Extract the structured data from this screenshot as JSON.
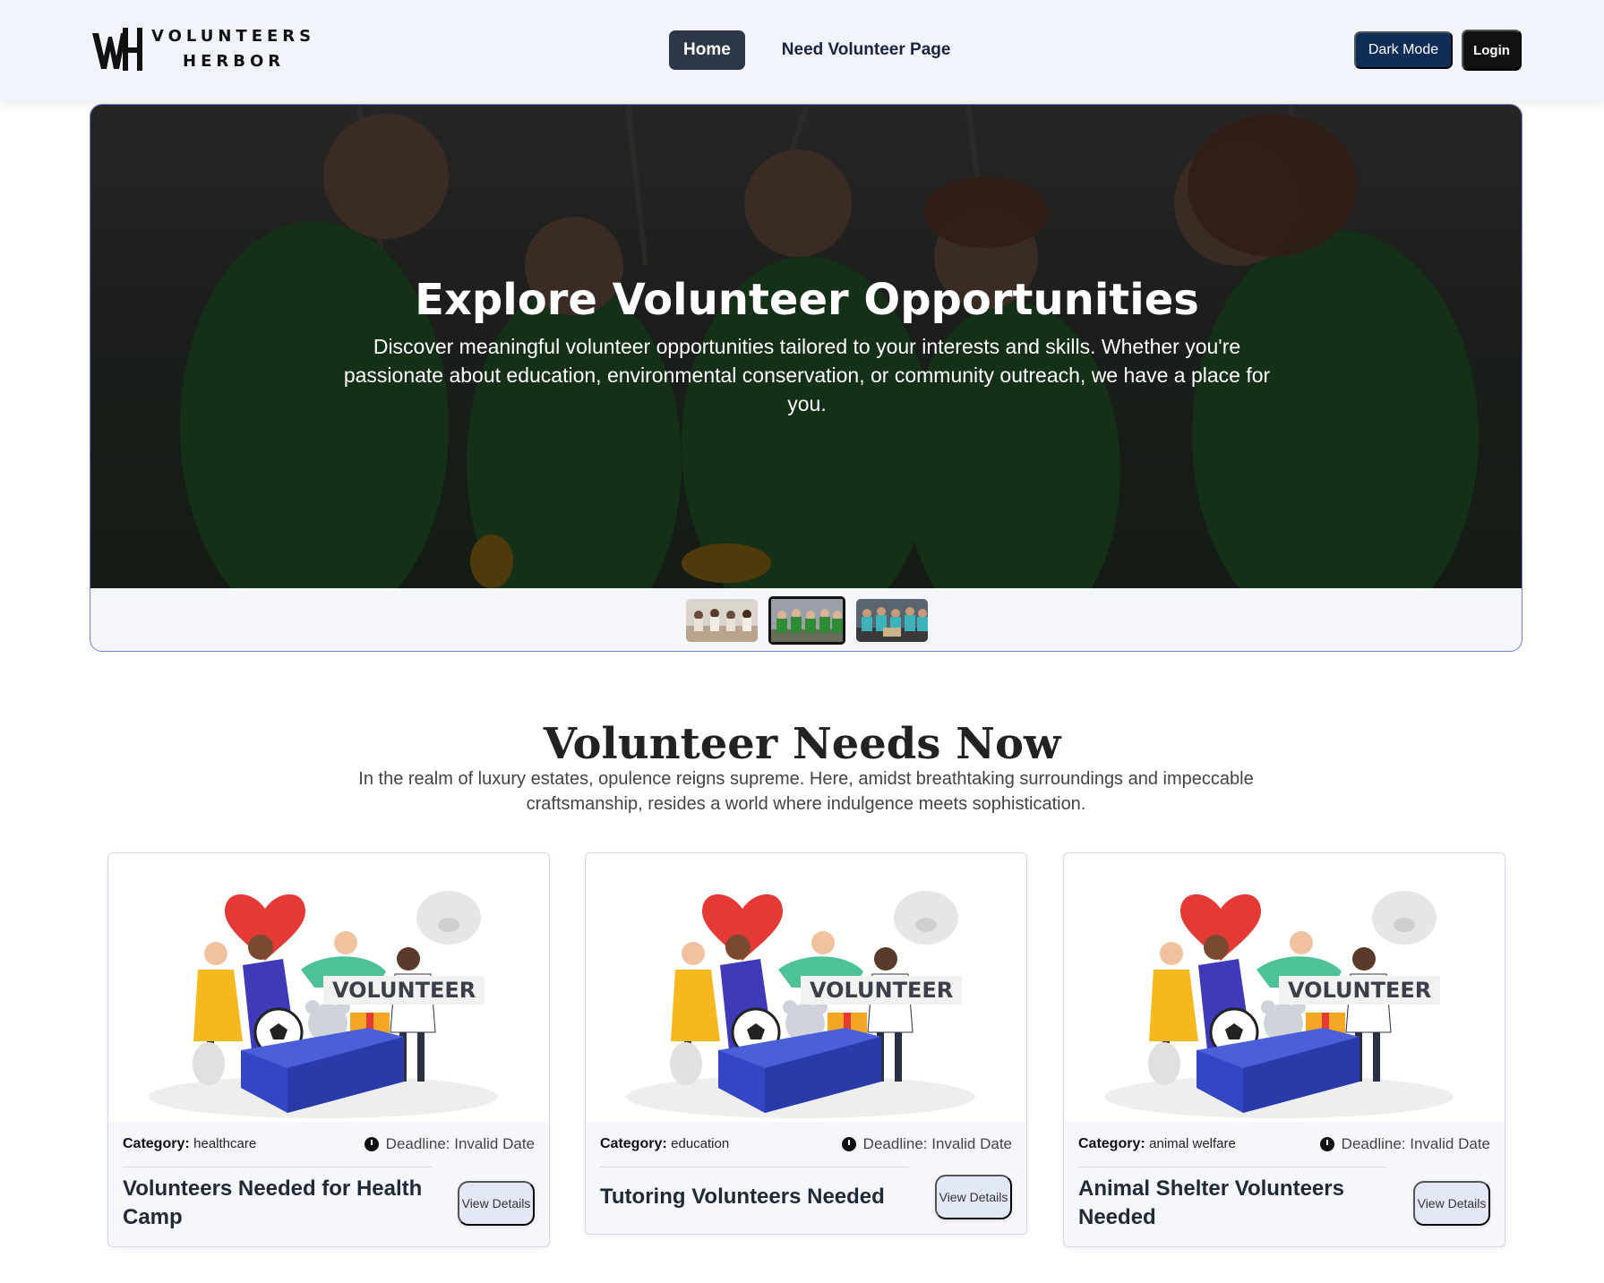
{
  "brand": {
    "line1": "VOLUNTEERS",
    "line2": "HERBOR"
  },
  "nav": {
    "home": "Home",
    "need_volunteer": "Need Volunteer Page"
  },
  "actions": {
    "dark_mode": "Dark Mode",
    "login": "Login"
  },
  "hero": {
    "title": "Explore Volunteer Opportunities",
    "description": "Discover meaningful volunteer opportunities tailored to your interests and skills. Whether you're passionate about education, environmental conservation, or community outreach, we have a place for you.",
    "active_slide": 2,
    "slide_count": 3
  },
  "section": {
    "title": "Volunteer Needs Now",
    "description": "In the realm of luxury estates, opulence reigns supreme. Here, amidst breathtaking surroundings and impeccable craftsmanship, resides a world where indulgence meets sophistication."
  },
  "cards": [
    {
      "category_label": "Category:",
      "category": "healthcare",
      "deadline": "Deadline: Invalid Date",
      "title": "Volunteers Needed for Health Camp",
      "button": "View Details",
      "image_label": "VOLUNTEER"
    },
    {
      "category_label": "Category:",
      "category": "education",
      "deadline": "Deadline: Invalid Date",
      "title": "Tutoring Volunteers Needed",
      "button": "View Details",
      "image_label": "VOLUNTEER"
    },
    {
      "category_label": "Category:",
      "category": "animal welfare",
      "deadline": "Deadline: Invalid Date",
      "title": "Animal Shelter Volunteers Needed",
      "button": "View Details",
      "image_label": "VOLUNTEER"
    }
  ]
}
